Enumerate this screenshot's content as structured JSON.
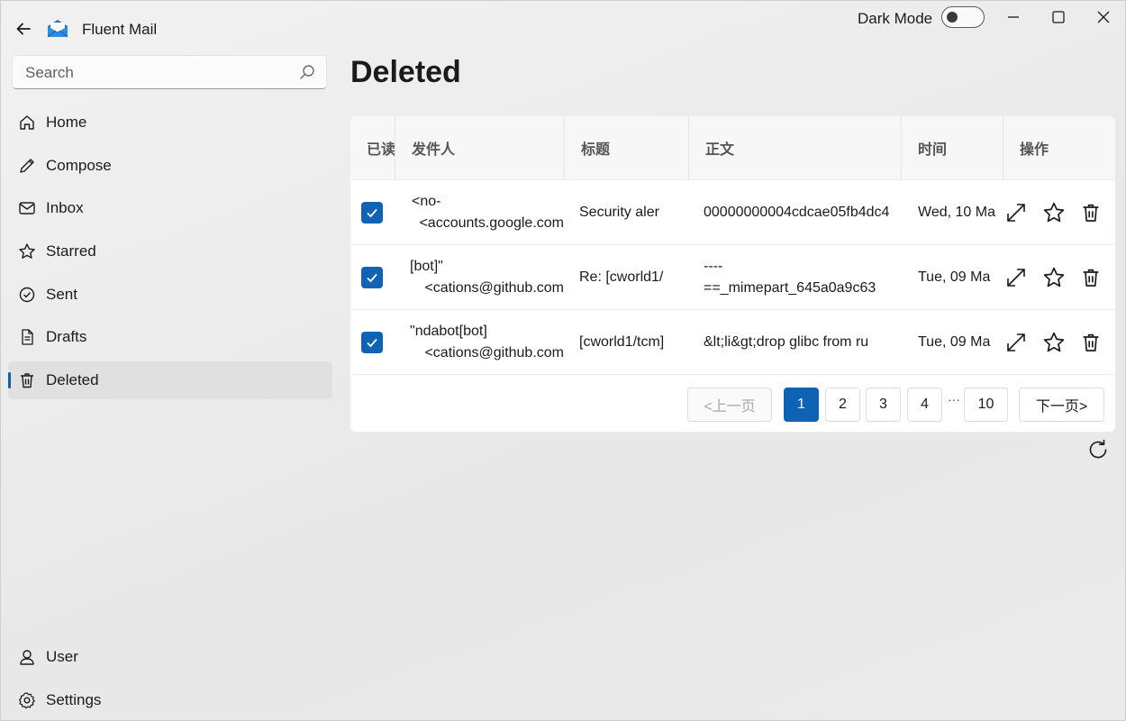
{
  "app": {
    "title": "Fluent Mail"
  },
  "titlebar": {
    "dark_mode_label": "Dark Mode"
  },
  "search": {
    "placeholder": "Search"
  },
  "nav": {
    "items": [
      {
        "label": "Home",
        "icon": "home-icon"
      },
      {
        "label": "Compose",
        "icon": "pencil-icon"
      },
      {
        "label": "Inbox",
        "icon": "mail-icon"
      },
      {
        "label": "Starred",
        "icon": "star-icon"
      },
      {
        "label": "Sent",
        "icon": "check-circle-icon"
      },
      {
        "label": "Drafts",
        "icon": "document-icon"
      },
      {
        "label": "Deleted",
        "icon": "trash-icon"
      }
    ],
    "footer": [
      {
        "label": "User",
        "icon": "user-icon"
      },
      {
        "label": "Settings",
        "icon": "gear-icon"
      }
    ]
  },
  "main": {
    "title": "Deleted",
    "columns": [
      "已读",
      "发件人",
      "标题",
      "正文",
      "时间",
      "操作"
    ],
    "rows": [
      {
        "read": true,
        "sender_line1": "<no-",
        "sender_line2": "accounts.google.com>",
        "subject": "Security aler",
        "body_line1": "00000000004cdcae05fb4dc4",
        "body_line2": "",
        "time": "Wed, 10 Ma"
      },
      {
        "read": true,
        "sender_line1": "[bot]\"",
        "sender_line2": "cations@github.com>",
        "subject": "Re: [cworld1/",
        "body_line1": "----",
        "body_line2": "==_mimepart_645a0a9c63",
        "time": "Tue, 09 Ma"
      },
      {
        "read": true,
        "sender_line1": "ndabot[bot]\"",
        "sender_line2": "cations@github.com>",
        "subject": "[cworld1/tcm]",
        "body_line1": "&lt;li&gt;drop glibc from ru",
        "body_line2": "",
        "time": "Tue, 09 Ma"
      }
    ],
    "pager": {
      "prev": "<上一页",
      "next": "下一页>",
      "pages": [
        "1",
        "2",
        "3",
        "4",
        "10"
      ],
      "current": "1",
      "ellipsis": "···"
    }
  },
  "colors": {
    "accent": "#0f62b4"
  }
}
